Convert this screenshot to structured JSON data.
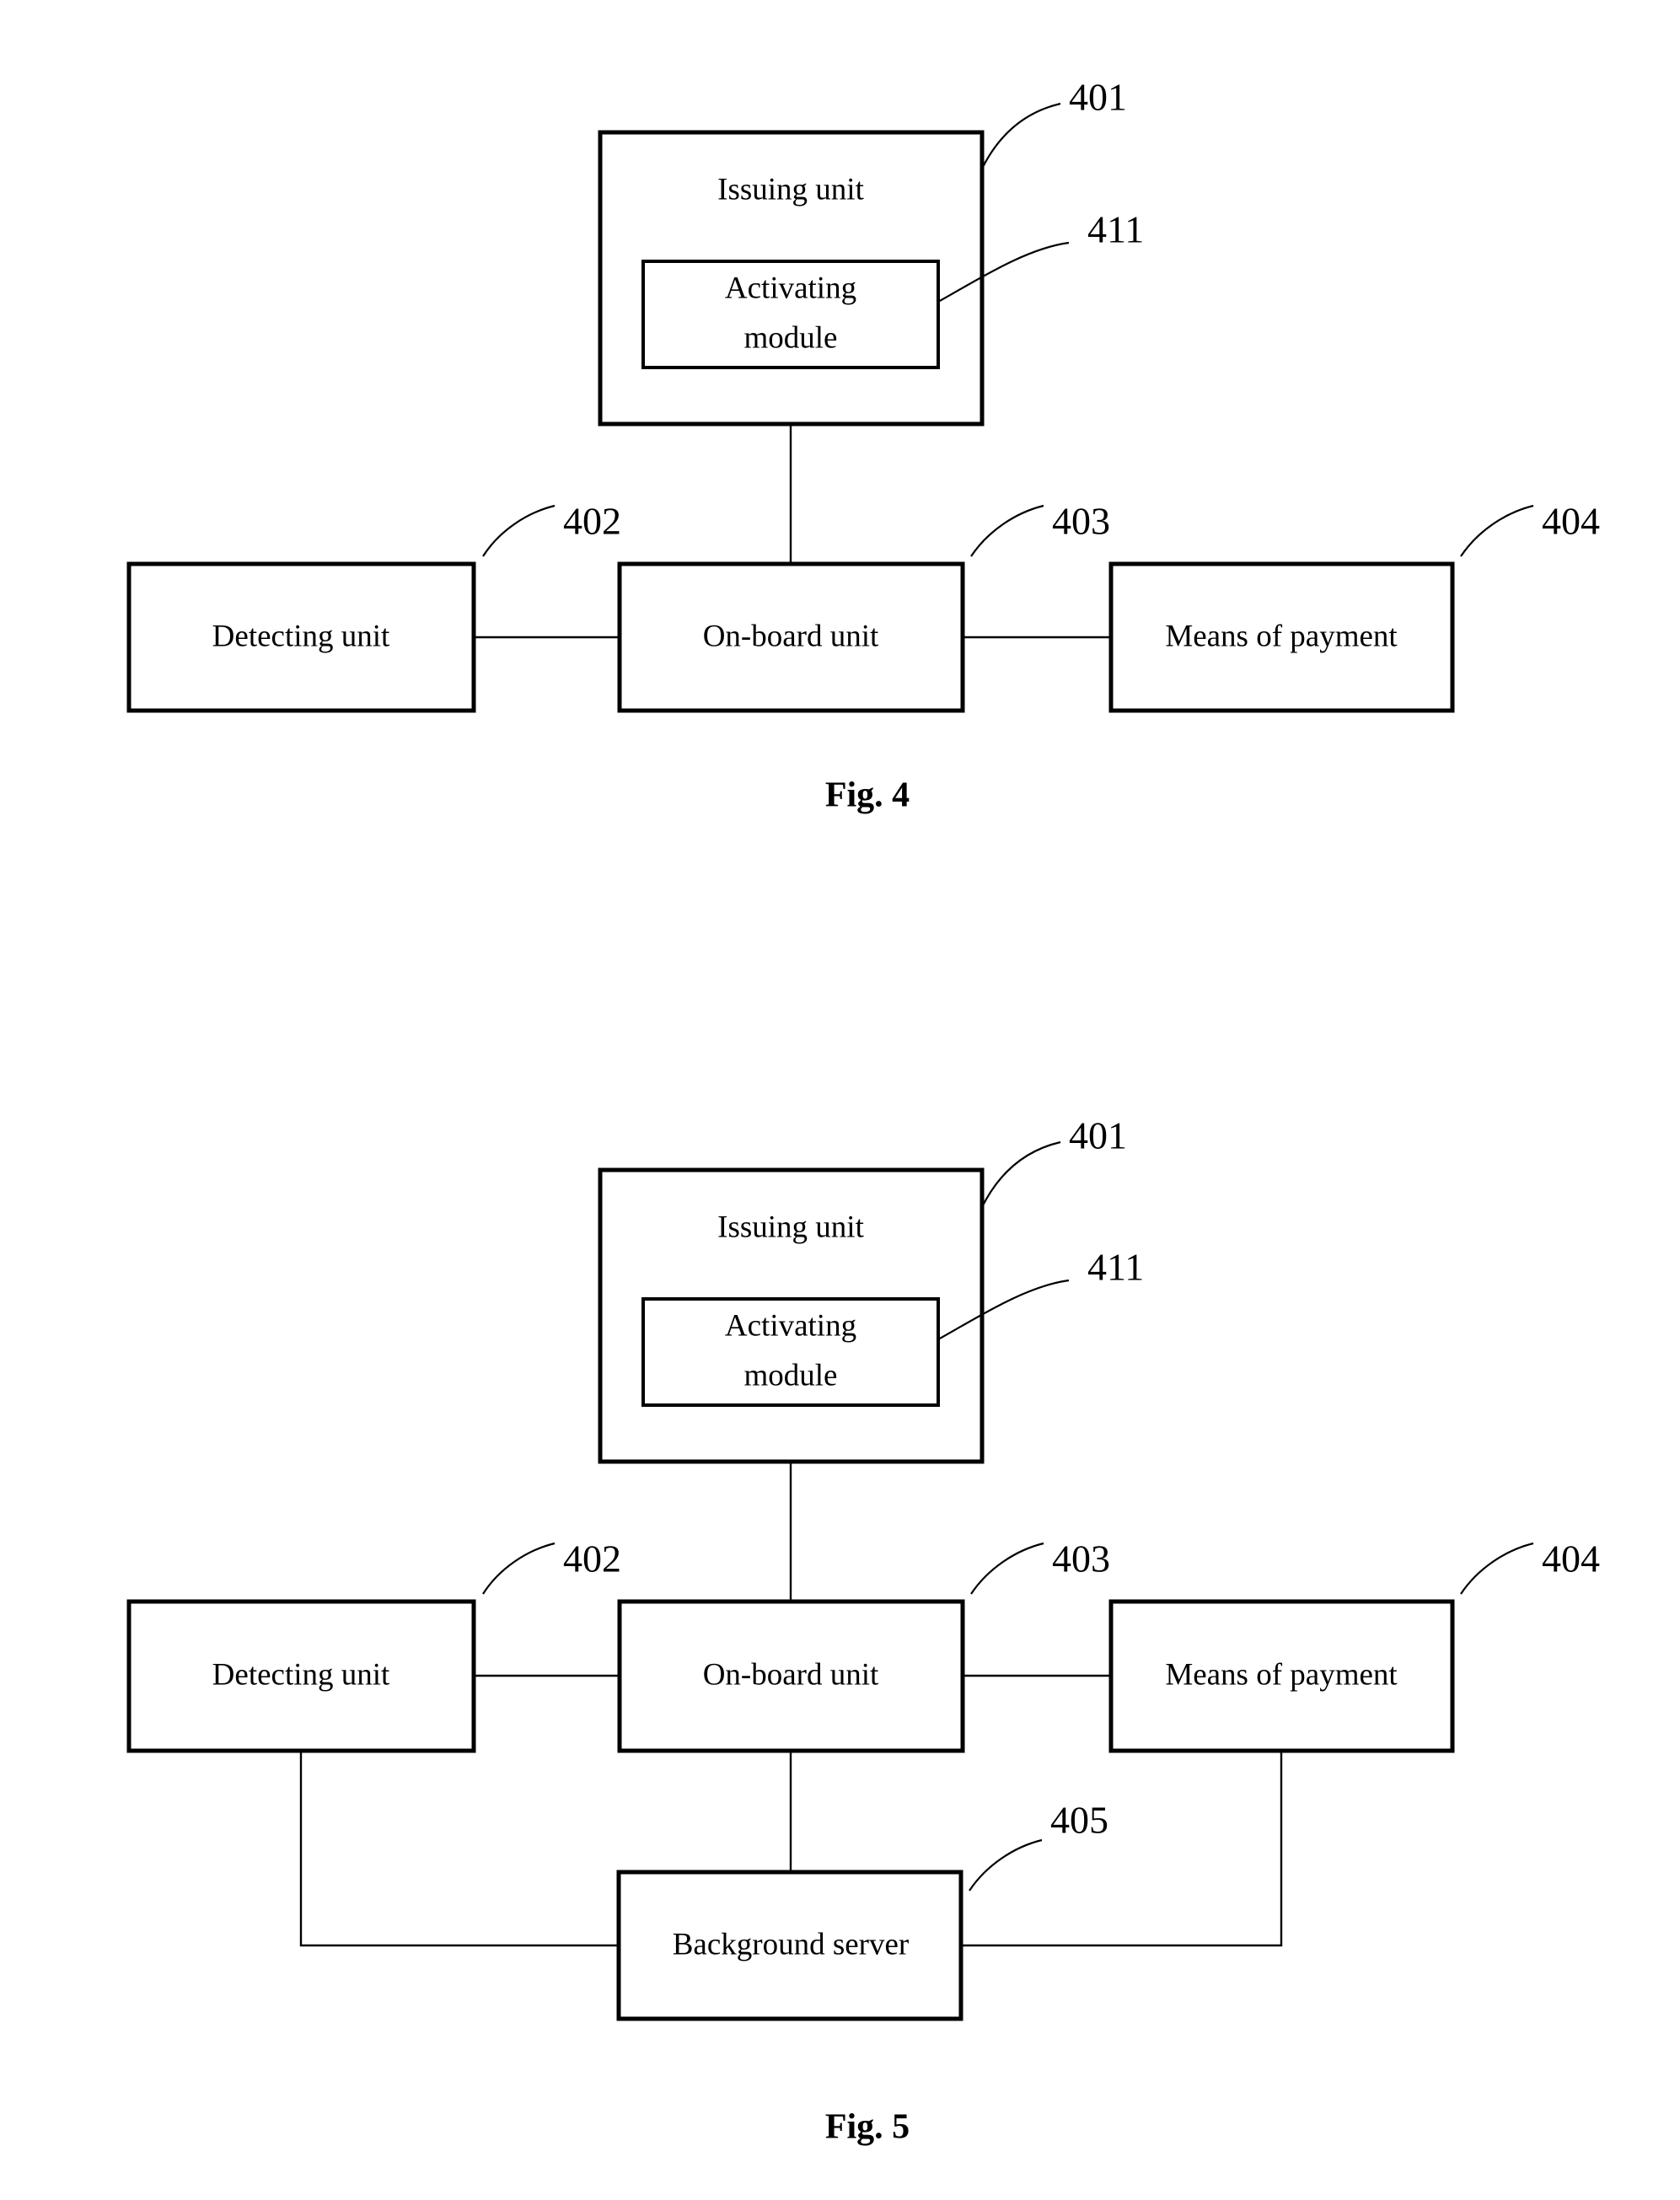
{
  "document": {
    "type": "patent-figure-sheet",
    "background_color": "#ffffff",
    "line_color": "#000000"
  },
  "figures": [
    {
      "id": "fig4",
      "caption": "Fig. 4",
      "blocks": [
        {
          "key": "issuing_unit",
          "label": "Issuing unit",
          "ref": "401"
        },
        {
          "key": "activating_module",
          "label": "Activating module",
          "line1": "Activating",
          "line2": "module",
          "ref": "411"
        },
        {
          "key": "detecting_unit",
          "label": "Detecting unit",
          "ref": "402"
        },
        {
          "key": "onboard_unit",
          "label": "On-board unit",
          "ref": "403"
        },
        {
          "key": "means_of_payment",
          "label": "Means of payment",
          "ref": "404"
        }
      ],
      "connections": [
        {
          "from": "issuing_unit",
          "to": "onboard_unit"
        },
        {
          "from": "detecting_unit",
          "to": "onboard_unit"
        },
        {
          "from": "onboard_unit",
          "to": "means_of_payment"
        }
      ]
    },
    {
      "id": "fig5",
      "caption": "Fig. 5",
      "blocks": [
        {
          "key": "issuing_unit",
          "label": "Issuing unit",
          "ref": "401"
        },
        {
          "key": "activating_module",
          "label": "Activating module",
          "line1": "Activating",
          "line2": "module",
          "ref": "411"
        },
        {
          "key": "detecting_unit",
          "label": "Detecting unit",
          "ref": "402"
        },
        {
          "key": "onboard_unit",
          "label": "On-board unit",
          "ref": "403"
        },
        {
          "key": "means_of_payment",
          "label": "Means of payment",
          "ref": "404"
        },
        {
          "key": "background_server",
          "label": "Background server",
          "ref": "405"
        }
      ],
      "connections": [
        {
          "from": "issuing_unit",
          "to": "onboard_unit"
        },
        {
          "from": "detecting_unit",
          "to": "onboard_unit"
        },
        {
          "from": "onboard_unit",
          "to": "means_of_payment"
        },
        {
          "from": "detecting_unit",
          "to": "background_server"
        },
        {
          "from": "onboard_unit",
          "to": "background_server"
        },
        {
          "from": "means_of_payment",
          "to": "background_server"
        }
      ]
    }
  ],
  "fig4": {
    "caption": "Fig. 4",
    "issuing_unit": {
      "label": "Issuing unit",
      "ref": "401"
    },
    "activating_module": {
      "line1": "Activating",
      "line2": "module",
      "ref": "411"
    },
    "detecting_unit": {
      "label": "Detecting unit",
      "ref": "402"
    },
    "onboard_unit": {
      "label": "On-board unit",
      "ref": "403"
    },
    "means_of_payment": {
      "label": "Means of payment",
      "ref": "404"
    }
  },
  "fig5": {
    "caption": "Fig. 5",
    "issuing_unit": {
      "label": "Issuing unit",
      "ref": "401"
    },
    "activating_module": {
      "line1": "Activating",
      "line2": "module",
      "ref": "411"
    },
    "detecting_unit": {
      "label": "Detecting unit",
      "ref": "402"
    },
    "onboard_unit": {
      "label": "On-board unit",
      "ref": "403"
    },
    "means_of_payment": {
      "label": "Means of payment",
      "ref": "404"
    },
    "background_server": {
      "label": "Background server",
      "ref": "405"
    }
  }
}
